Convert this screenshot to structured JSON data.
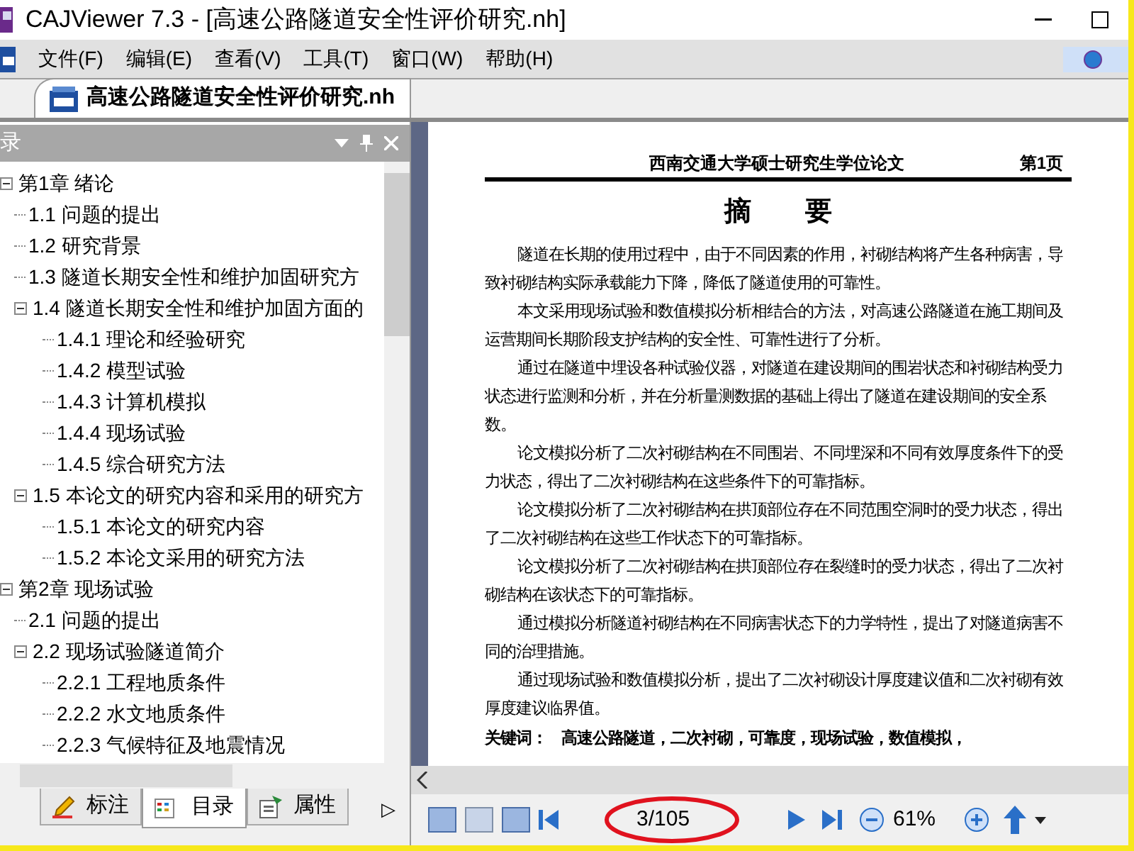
{
  "window": {
    "title": "CAJViewer 7.3 - [高速公路隧道安全性评价研究.nh]"
  },
  "menu": [
    "文件(F)",
    "编辑(E)",
    "查看(V)",
    "工具(T)",
    "窗口(W)",
    "帮助(H)"
  ],
  "document_tabs": [
    {
      "label": "高速公路隧道安全性评价研究.nh",
      "selected": true
    }
  ],
  "sidebar": {
    "title": "录",
    "tree": [
      {
        "label": "第1章 绪论",
        "expanded": true,
        "children": [
          {
            "label": "1.1 问题的提出"
          },
          {
            "label": "1.2 研究背景"
          },
          {
            "label": "1.3 隧道长期安全性和维护加固研究方"
          },
          {
            "label": "1.4 隧道长期安全性和维护加固方面的",
            "expanded": true,
            "children": [
              {
                "label": "1.4.1 理论和经验研究"
              },
              {
                "label": "1.4.2 模型试验"
              },
              {
                "label": "1.4.3 计算机模拟"
              },
              {
                "label": "1.4.4 现场试验"
              },
              {
                "label": "1.4.5 综合研究方法"
              }
            ]
          },
          {
            "label": "1.5 本论文的研究内容和采用的研究方",
            "expanded": true,
            "children": [
              {
                "label": "1.5.1 本论文的研究内容"
              },
              {
                "label": "1.5.2 本论文采用的研究方法"
              }
            ]
          }
        ]
      },
      {
        "label": "第2章 现场试验",
        "expanded": true,
        "children": [
          {
            "label": "2.1 问题的提出"
          },
          {
            "label": "2.2 现场试验隧道简介",
            "expanded": true,
            "children": [
              {
                "label": "2.2.1 工程地质条件"
              },
              {
                "label": "2.2.2 水文地质条件"
              },
              {
                "label": "2.2.3 气候特征及地震情况"
              }
            ]
          }
        ]
      }
    ],
    "tabs": [
      {
        "label": "标注",
        "selected": false
      },
      {
        "label": "目录",
        "selected": true
      },
      {
        "label": "属性",
        "selected": false
      }
    ],
    "tab_scroll": "▷"
  },
  "page": {
    "header": "西南交通大学硕士研究生学位论文",
    "page_label": "第1页",
    "heading": "摘　　要",
    "paragraphs": [
      "隧道在长期的使用过程中，由于不同因素的作用，衬砌结构将产生各种病害，导致衬砌结构实际承载能力下降，降低了隧道使用的可靠性。",
      "本文采用现场试验和数值模拟分析相结合的方法，对高速公路隧道在施工期间及运营期间长期阶段支护结构的安全性、可靠性进行了分析。",
      "通过在隧道中埋设各种试验仪器，对隧道在建设期间的围岩状态和衬砌结构受力状态进行监测和分析，并在分析量测数据的基础上得出了隧道在建设期间的安全系数。",
      "论文模拟分析了二次衬砌结构在不同围岩、不同埋深和不同有效厚度条件下的受力状态，得出了二次衬砌结构在这些条件下的可靠指标。",
      "论文模拟分析了二次衬砌结构在拱顶部位存在不同范围空洞时的受力状态，得出了二次衬砌结构在这些工作状态下的可靠指标。",
      "论文模拟分析了二次衬砌结构在拱顶部位存在裂缝时的受力状态，得出了二次衬砌结构在该状态下的可靠指标。",
      "通过模拟分析隧道衬砌结构在不同病害状态下的力学特性，提出了对隧道病害不同的治理措施。",
      "通过现场试验和数值模拟分析，提出了二次衬砌设计厚度建议值和二次衬砌有效厚度建议临界值。"
    ],
    "keywords_label": "关键词：",
    "keywords": "高速公路隧道，二次衬砌，可靠度，现场试验，数值模拟，"
  },
  "toolbar": {
    "page_field": "3/105",
    "zoom": "61%"
  }
}
